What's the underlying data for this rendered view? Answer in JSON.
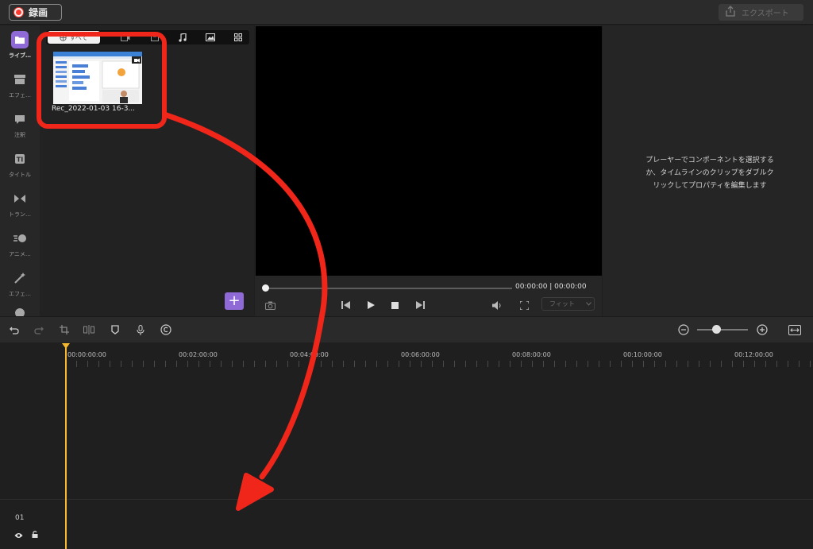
{
  "topbar": {
    "record_label": "録画",
    "export_label": "エクスポート"
  },
  "sidebar": {
    "items": [
      {
        "label": "ライブ…",
        "icon": "folder-icon",
        "active": true
      },
      {
        "label": "エフェ…",
        "icon": "store-icon"
      },
      {
        "label": "注釈",
        "icon": "speech-bubble-icon"
      },
      {
        "label": "タイトル",
        "icon": "title-icon"
      },
      {
        "label": "トラン…",
        "icon": "transition-icon"
      },
      {
        "label": "アニメ…",
        "icon": "animation-icon"
      },
      {
        "label": "エフェ…",
        "icon": "magic-wand-icon"
      }
    ]
  },
  "library": {
    "tabs": {
      "all_label": "すべて"
    },
    "clip": {
      "name": "Rec_2022-01-03 16-3..."
    }
  },
  "preview": {
    "timecode": "00:00:00 | 00:00:00",
    "fit_label": "フィット"
  },
  "properties": {
    "message_line1": "プレーヤーでコンポーネントを選択する",
    "message_line2": "か、タイムラインのクリップをダブルク",
    "message_line3": "リックしてプロパティを編集します"
  },
  "timeline": {
    "ruler": [
      "00:00:00:00",
      "00:02:00:00",
      "00:04:00:00",
      "00:06:00:00",
      "00:08:00:00",
      "00:10:00:00",
      "00:12:00:00"
    ],
    "track": {
      "number": "01"
    }
  },
  "colors": {
    "accent": "#8f69d6",
    "record": "#ff3b30",
    "playhead": "#f5b82e",
    "annotation": "#f0261a"
  }
}
